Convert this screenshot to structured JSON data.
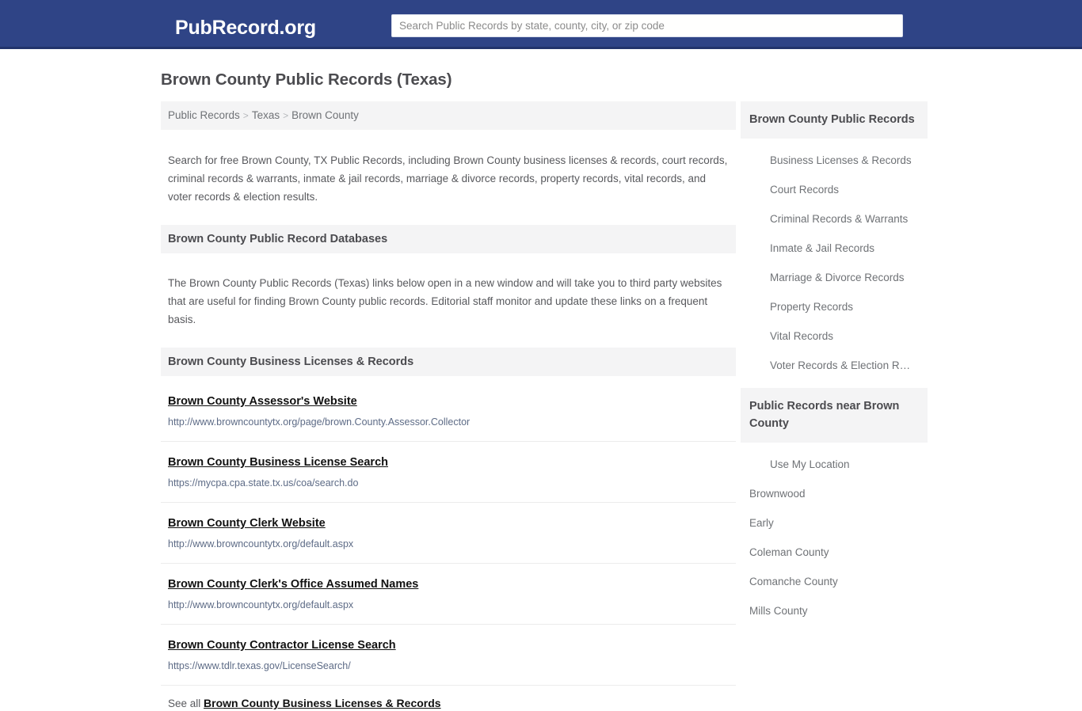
{
  "header": {
    "brand": "PubRecord.org",
    "search_placeholder": "Search Public Records by state, county, city, or zip code",
    "search_value": "",
    "bar_color": "#2f4486"
  },
  "page": {
    "title": "Brown County Public Records (Texas)"
  },
  "breadcrumb": {
    "items": [
      {
        "label": "Public Records"
      },
      {
        "label": "Texas"
      },
      {
        "label": "Brown County"
      }
    ],
    "separator": ">"
  },
  "intro": {
    "text": "Search for free Brown County, TX Public Records, including Brown County business licenses & records, court records, criminal records & warrants, inmate & jail records, marriage & divorce records, property records, vital records, and voter records & election results."
  },
  "databases_section": {
    "heading": "Brown County Public Record Databases",
    "note": "The Brown County Public Records (Texas) links below open in a new window and will take you to third party websites that are useful for finding Brown County public records. Editorial staff monitor and update these links on a frequent basis."
  },
  "business_section": {
    "heading": "Brown County Business Licenses & Records",
    "links": [
      {
        "title": "Brown County Assessor's Website",
        "url": "http://www.browncountytx.org/page/brown.County.Assessor.Collector"
      },
      {
        "title": "Brown County Business License Search",
        "url": "https://mycpa.cpa.state.tx.us/coa/search.do"
      },
      {
        "title": "Brown County Clerk Website",
        "url": "http://www.browncountytx.org/default.aspx"
      },
      {
        "title": "Brown County Clerk's Office Assumed Names",
        "url": "http://www.browncountytx.org/default.aspx"
      },
      {
        "title": "Brown County Contractor License Search",
        "url": "https://www.tdlr.texas.gov/LicenseSearch/"
      }
    ],
    "see_all_prefix": "See all",
    "see_all_label": "Brown County Business Licenses & Records"
  },
  "sidebar": {
    "records_box": {
      "heading": "Brown County Public Records",
      "items": [
        {
          "label": "Business Licenses & Records"
        },
        {
          "label": "Court Records"
        },
        {
          "label": "Criminal Records & Warrants"
        },
        {
          "label": "Inmate & Jail Records"
        },
        {
          "label": "Marriage & Divorce Records"
        },
        {
          "label": "Property Records"
        },
        {
          "label": "Vital Records"
        },
        {
          "label": "Voter Records & Election R…"
        }
      ]
    },
    "near_box": {
      "heading": "Public Records near Brown County",
      "items": [
        {
          "label": "Use My Location",
          "indented": true
        },
        {
          "label": "Brownwood",
          "indented": false
        },
        {
          "label": "Early",
          "indented": false
        },
        {
          "label": "Coleman County",
          "indented": false
        },
        {
          "label": "Comanche County",
          "indented": false
        },
        {
          "label": "Mills County",
          "indented": false
        }
      ]
    }
  }
}
